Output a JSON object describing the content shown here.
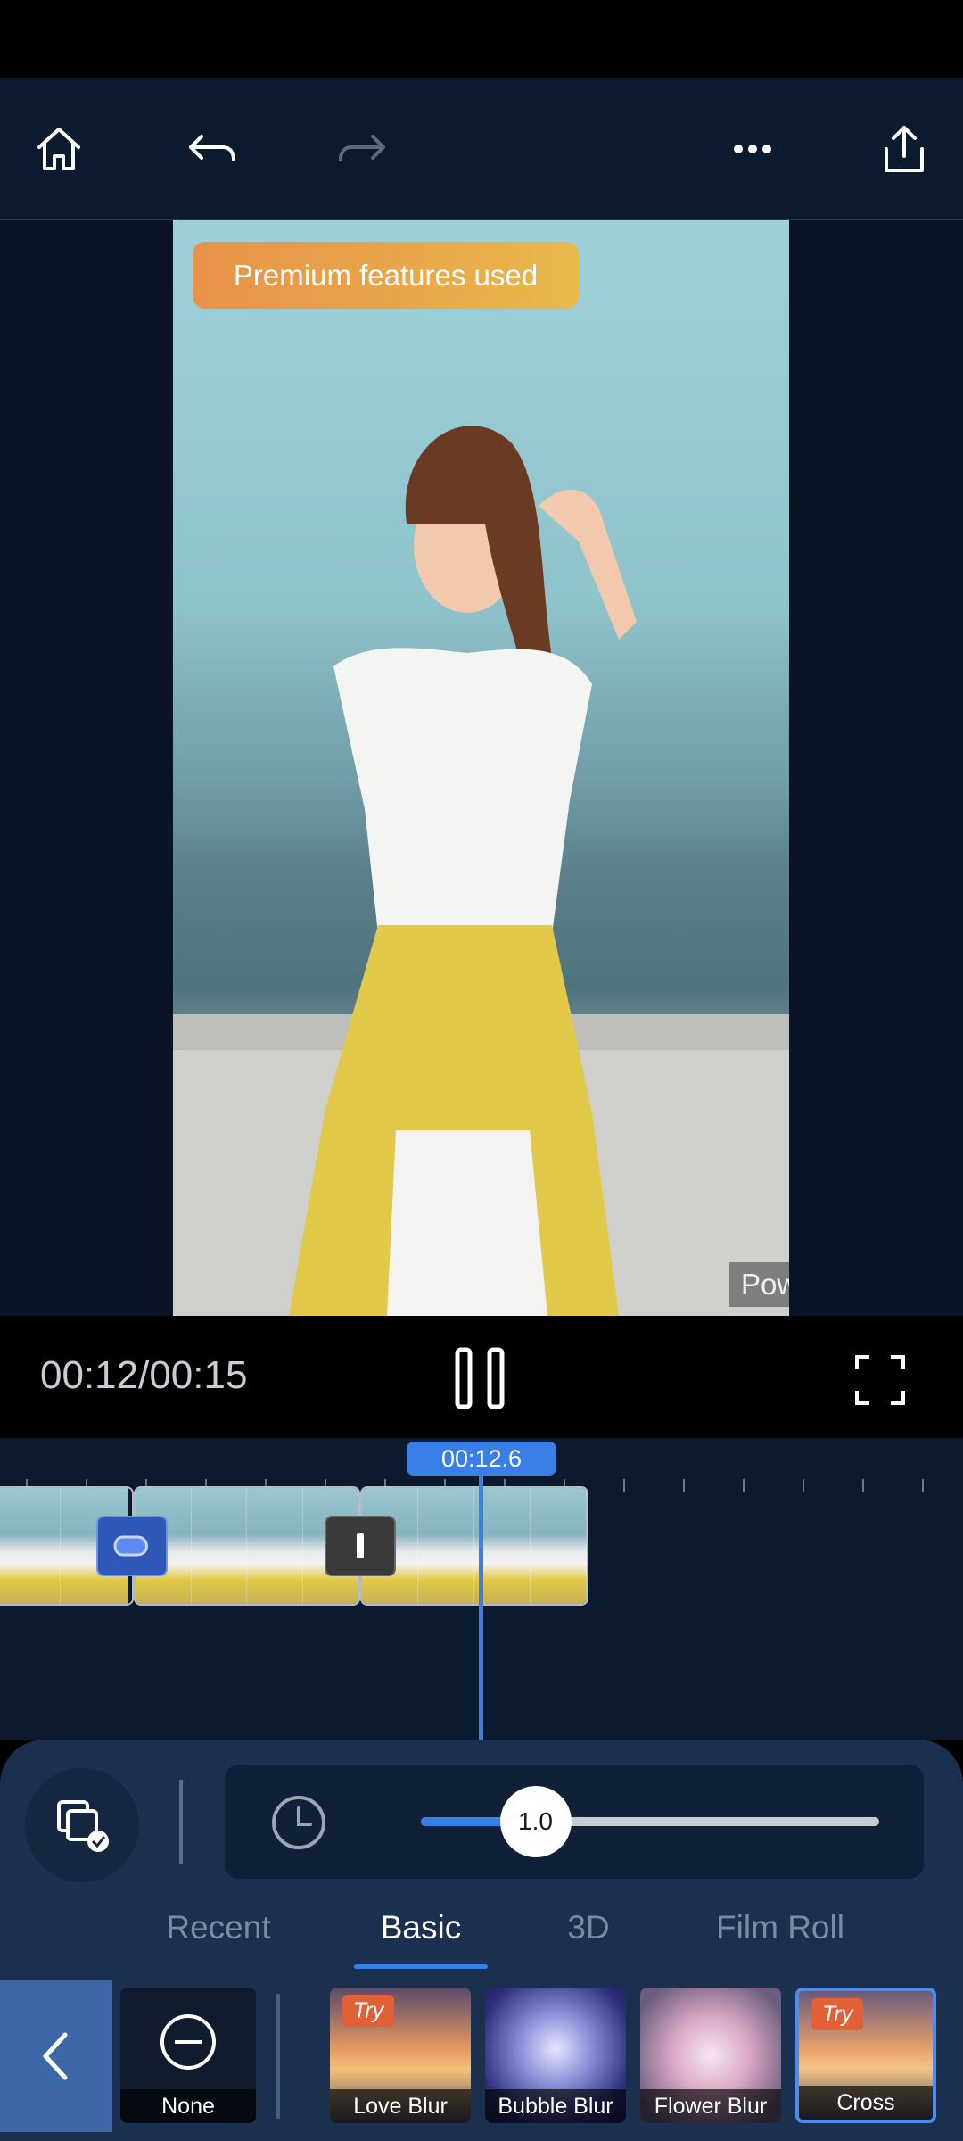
{
  "toolbar": {
    "icons": [
      "home-icon",
      "undo-icon",
      "redo-icon",
      "more-icon",
      "share-icon"
    ]
  },
  "preview": {
    "premium_label": "Premium features used",
    "watermark": "PowerDirector"
  },
  "playback": {
    "time": "00:12/00:15",
    "state": "playing"
  },
  "timeline": {
    "indicator": "00:12.6"
  },
  "effect_panel": {
    "speed_value": "1.0",
    "speed_fraction": 0.25,
    "tabs": [
      {
        "label": "Recent"
      },
      {
        "label": "Basic"
      },
      {
        "label": "3D"
      },
      {
        "label": "Film Roll"
      }
    ],
    "active_tab": "Basic",
    "effects": [
      {
        "label": "None",
        "try": ""
      },
      {
        "label": "Love Blur",
        "try": "Try"
      },
      {
        "label": "Bubble Blur",
        "try": ""
      },
      {
        "label": "Flower Blur",
        "try": ""
      },
      {
        "label": "Cross",
        "try": "Try"
      }
    ],
    "selected_effect": "Cross"
  },
  "colors": {
    "accent": "#3a7fe8",
    "toolbar_bg": "#0c1a30",
    "panel_bg": "#1b2f4f",
    "premium_start": "#e8924a",
    "premium_end": "#e9b84a",
    "try_badge": "#e35f35"
  }
}
